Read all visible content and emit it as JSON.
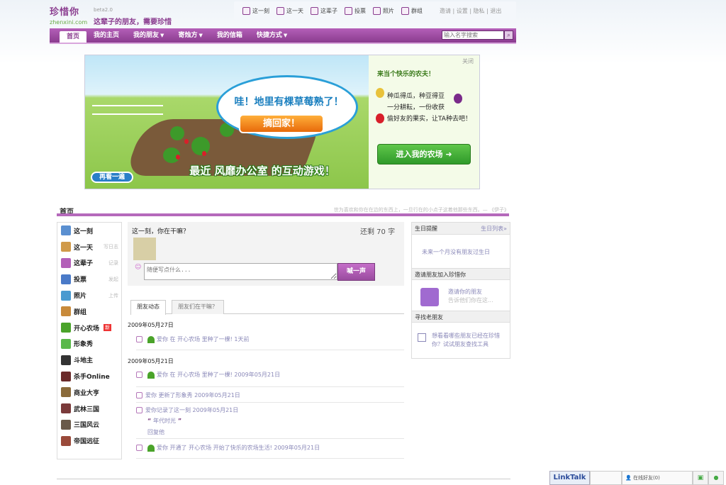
{
  "header": {
    "logo_text": "珍惜你",
    "logo_domain": "zhenxini.com",
    "beta": "beta2.0",
    "slogan": "这辈子的朋友，需要珍惜",
    "toplinks": [
      "这一刻",
      "这一天",
      "这辈子",
      "投票",
      "照片",
      "群组"
    ],
    "utils": "邀请 | 设置 | 隐私 | 退出"
  },
  "nav": {
    "items": [
      "首页",
      "我的主页",
      "我的朋友",
      "寄烛方",
      "我的信箱",
      "快捷方式"
    ],
    "search_placeholder": "输入名字搜索",
    "search_icon": "search-icon"
  },
  "banner": {
    "close": "关闭",
    "bubble": "哇！地里有棵草莓熟了！",
    "pick_button": "摘回家！",
    "tagline": "最近 风靡办公室 的互动游戏！",
    "replay": "再看一遍",
    "title": "来当个快乐的农夫！",
    "line1": "种瓜得瓜，种豆得豆",
    "line2": "一分耕耘，一份收获",
    "line3": "偷好友的果实，让TA种去吧！",
    "enter_button": "进入我的农场"
  },
  "section": {
    "title": "首页",
    "quote": "世为喜欢和你在在边的东西上，一旦行在的小点子这着他那些东西。— 《伊子》"
  },
  "leftmenu": [
    {
      "label": "这一刻",
      "extra": "",
      "new": false,
      "color": "#5a8fd0"
    },
    {
      "label": "这一天",
      "extra": "写日志",
      "new": false,
      "color": "#d09a4a"
    },
    {
      "label": "这辈子",
      "extra": "记录",
      "new": false,
      "color": "#b35fb8"
    },
    {
      "label": "投票",
      "extra": "发起",
      "new": false,
      "color": "#4a7ac8"
    },
    {
      "label": "照片",
      "extra": "上传",
      "new": false,
      "color": "#4a9ad0"
    },
    {
      "label": "群组",
      "extra": "",
      "new": false,
      "color": "#c88a3a"
    },
    {
      "label": "开心农场",
      "extra": "",
      "new": true,
      "new_label": "新",
      "color": "#4aa32a"
    },
    {
      "label": "形象秀",
      "extra": "",
      "new": false,
      "color": "#5ab84a"
    },
    {
      "label": "斗地主",
      "extra": "",
      "new": false,
      "color": "#333333"
    },
    {
      "label": "杀手Online",
      "extra": "",
      "new": false,
      "color": "#6a2a2a"
    },
    {
      "label": "商业大亨",
      "extra": "",
      "new": false,
      "color": "#8a6a3a"
    },
    {
      "label": "武林三国",
      "extra": "",
      "new": false,
      "color": "#7a3a3a"
    },
    {
      "label": "三国风云",
      "extra": "",
      "new": false,
      "color": "#6a5a4a"
    },
    {
      "label": "帝国远征",
      "extra": "",
      "new": false,
      "color": "#9a4a3a"
    }
  ],
  "status": {
    "question": "这一刻，你在干嘛？",
    "count": "还剩 70 字",
    "placeholder": "随便写点什么...",
    "submit": "喊一声",
    "smile_icon": "smile-icon"
  },
  "tabs": [
    "朋友动态",
    "朋友们在干嘛？"
  ],
  "feed": {
    "date1": "2009年05月27日",
    "item1": "爱你 在 开心农场 里种了一棵! 1天前",
    "date2": "2009年05月21日",
    "item2": "爱你 在 开心农场 里种了一棵! 2009年05月21日",
    "item3": "爱你 更新了形象秀   2009年05月21日",
    "item4": "爱你记录了这一刻   2009年05月21日",
    "item4_quote": "年代时光",
    "item4_reply": "回复他",
    "item5": "爱你 开通了 开心农场 开始了快乐的农场生活! 2009年05月21日"
  },
  "right": {
    "birthday_title": "生日提醒",
    "birthday_more": "生日列表»",
    "birthday_text": "未来一个月没有朋友过生日",
    "invite_title": "邀请朋友加入珍惜你",
    "invite_link": "邀请你的朋友",
    "invite_sub": "告诉他们你在这...",
    "find_title": "寻找老朋友",
    "find_text": "想看看哪些朋友已经在珍惜你？试试朋友查找工具"
  },
  "bottombar": {
    "linktalk": "LinkTalk",
    "friends": "在线好友(0)"
  }
}
